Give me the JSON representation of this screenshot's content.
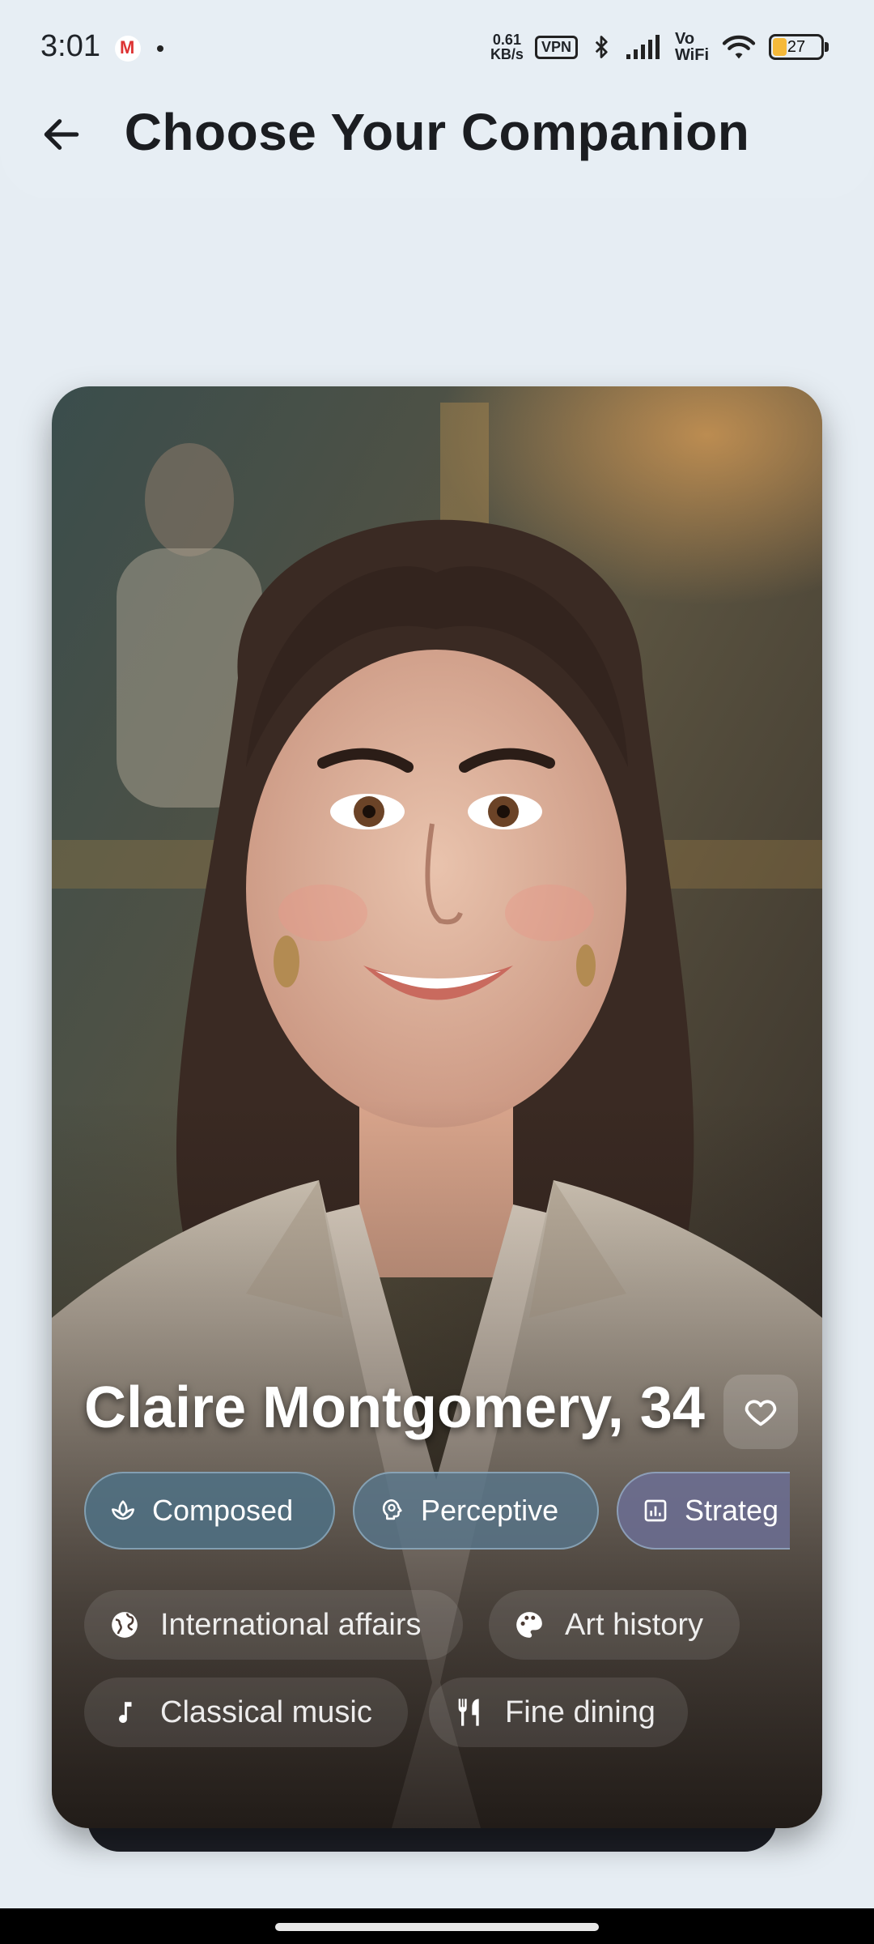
{
  "status_bar": {
    "time": "3:01",
    "net_speed_value": "0.61",
    "net_speed_unit": "KB/s",
    "vpn": "VPN",
    "vowifi_top": "Vo",
    "vowifi_bottom": "WiFi",
    "battery_level": "27",
    "battery_fraction": 0.27
  },
  "header": {
    "title": "Choose Your Companion"
  },
  "profile": {
    "name": "Claire Montgomery, 34",
    "traits": [
      {
        "label": "Composed",
        "icon": "lotus-icon"
      },
      {
        "label": "Perceptive",
        "icon": "mind-icon"
      },
      {
        "label": "Strateg",
        "icon": "chart-icon"
      }
    ],
    "interests": [
      {
        "label": "International affairs",
        "icon": "globe-icon"
      },
      {
        "label": "Art history",
        "icon": "palette-icon"
      },
      {
        "label": "Classical music",
        "icon": "music-note-icon"
      },
      {
        "label": "Fine dining",
        "icon": "utensils-icon"
      }
    ]
  },
  "colors": {
    "background": "#e6edf3",
    "title_text": "#1b1d21",
    "chip_teal": "#4f7185",
    "chip_violet": "#6c6f94"
  }
}
